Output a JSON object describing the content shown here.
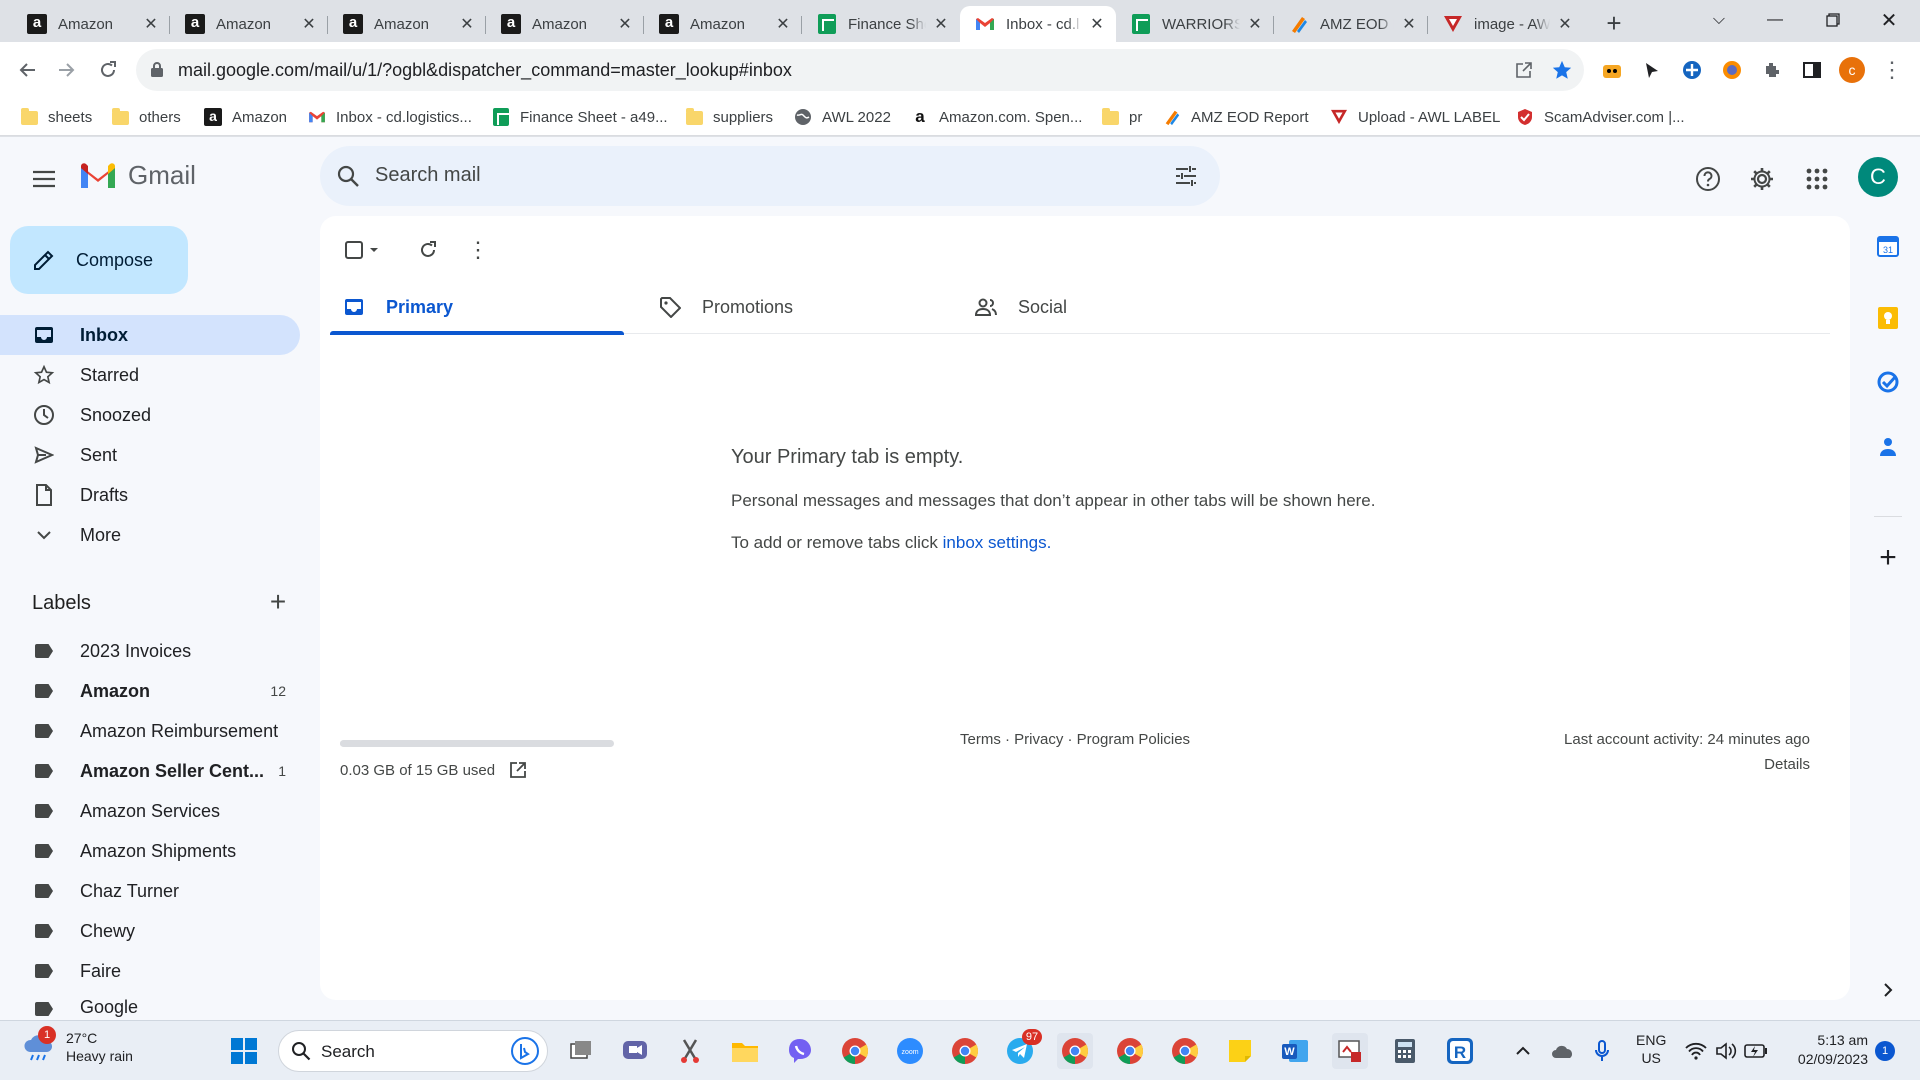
{
  "browser": {
    "tabs": [
      {
        "title": "Amazon",
        "favicon": "amazon-icon"
      },
      {
        "title": "Amazon",
        "favicon": "amazon-icon"
      },
      {
        "title": "Amazon",
        "favicon": "amazon-icon"
      },
      {
        "title": "Amazon",
        "favicon": "amazon-icon"
      },
      {
        "title": "Amazon",
        "favicon": "amazon-icon"
      },
      {
        "title": "Finance She",
        "favicon": "sheets-icon"
      },
      {
        "title": "Inbox - cd.l",
        "favicon": "gmail-icon",
        "active": true
      },
      {
        "title": "WARRIORS",
        "favicon": "sheets-icon"
      },
      {
        "title": "AMZ EOD F",
        "favicon": "report-icon"
      },
      {
        "title": "image - AW",
        "favicon": "awl-icon"
      }
    ],
    "url": "mail.google.com/mail/u/1/?ogbl&dispatcher_command=master_lookup#inbox",
    "profile_initial": "c",
    "bookmarks": [
      {
        "label": "sheets",
        "icon": "folder-icon"
      },
      {
        "label": "others",
        "icon": "folder-icon"
      },
      {
        "label": "Amazon",
        "icon": "amazon-icon"
      },
      {
        "label": "Inbox - cd.logistics...",
        "icon": "gmail-icon"
      },
      {
        "label": "Finance Sheet - a49...",
        "icon": "sheets-icon"
      },
      {
        "label": "suppliers",
        "icon": "folder-icon"
      },
      {
        "label": "AWL 2022",
        "icon": "globe-icon"
      },
      {
        "label": "Amazon.com. Spen...",
        "icon": "amazon-a-icon"
      },
      {
        "label": "pr",
        "icon": "folder-icon"
      },
      {
        "label": "AMZ EOD Report",
        "icon": "report-icon"
      },
      {
        "label": "Upload - AWL LABEL",
        "icon": "awl-icon"
      },
      {
        "label": "ScamAdviser.com |...",
        "icon": "shield-icon"
      }
    ]
  },
  "gmail": {
    "logo_text": "Gmail",
    "search_placeholder": "Search mail",
    "avatar_initial": "C",
    "compose_label": "Compose",
    "nav": [
      {
        "label": "Inbox",
        "icon": "inbox-icon",
        "active": true
      },
      {
        "label": "Starred",
        "icon": "star-icon"
      },
      {
        "label": "Snoozed",
        "icon": "clock-icon"
      },
      {
        "label": "Sent",
        "icon": "send-icon"
      },
      {
        "label": "Drafts",
        "icon": "draft-icon"
      },
      {
        "label": "More",
        "icon": "chevron-down-icon"
      }
    ],
    "labels_heading": "Labels",
    "labels": [
      {
        "label": "2023 Invoices",
        "count": ""
      },
      {
        "label": "Amazon",
        "count": "12",
        "bold": true
      },
      {
        "label": "Amazon Reimbursement",
        "count": ""
      },
      {
        "label": "Amazon Seller Cent...",
        "count": "1",
        "bold": true
      },
      {
        "label": "Amazon Services",
        "count": ""
      },
      {
        "label": "Amazon Shipments",
        "count": ""
      },
      {
        "label": "Chaz Turner",
        "count": ""
      },
      {
        "label": "Chewy",
        "count": ""
      },
      {
        "label": "Faire",
        "count": ""
      },
      {
        "label": "Google",
        "count": ""
      }
    ],
    "inbox_tabs": [
      {
        "label": "Primary",
        "icon": "inbox-icon",
        "active": true
      },
      {
        "label": "Promotions",
        "icon": "tag-icon"
      },
      {
        "label": "Social",
        "icon": "people-icon"
      }
    ],
    "empty": {
      "heading": "Your Primary tab is empty.",
      "line1": "Personal messages and messages that don’t appear in other tabs will be shown here.",
      "line2_prefix": "To add or remove tabs click ",
      "line2_link": "inbox settings",
      "line2_suffix": "."
    },
    "storage": {
      "text": "0.03 GB of 15 GB used",
      "used_fraction": 0.002
    },
    "footer_links": "Terms · Privacy · Program Policies",
    "last_activity": "Last account activity: 24 minutes ago",
    "details_link": "Details"
  },
  "taskbar": {
    "weather_temp": "27°C",
    "weather_desc": "Heavy rain",
    "weather_badge": "1",
    "search_label": "Search",
    "telegram_badge": "97",
    "lang": "ENG",
    "region": "US",
    "time": "5:13 am",
    "date": "02/09/2023",
    "notif_count": "1"
  }
}
